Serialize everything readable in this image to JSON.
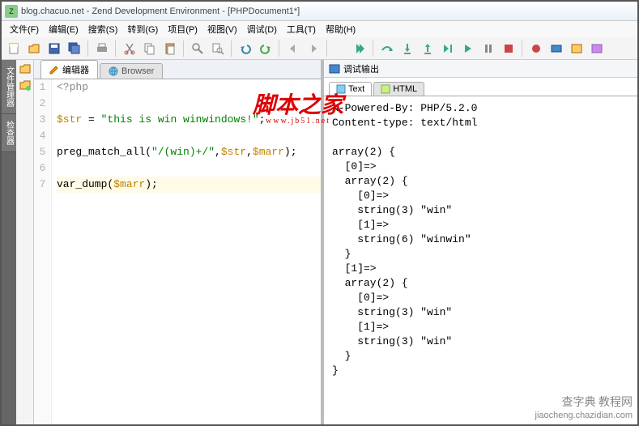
{
  "window": {
    "title": "blog.chacuo.net - Zend Development Environment - [PHPDocument1*]"
  },
  "menu": {
    "file": "文件(F)",
    "edit": "编辑(E)",
    "search": "搜索(S)",
    "goto": "转到(G)",
    "project": "项目(P)",
    "view": "视图(V)",
    "debug": "调试(D)",
    "tools": "工具(T)",
    "help": "帮助(H)"
  },
  "vtabs": {
    "file_manager": "文件管理器",
    "inspector": "检查器"
  },
  "editor_tabs": {
    "editor": "编辑器",
    "browser": "Browser"
  },
  "code": {
    "l1": "<?php",
    "l2": "",
    "l3_a": "$str",
    "l3_b": " = ",
    "l3_c": "\"this is win winwindows!\"",
    "l3_d": ";",
    "l4": "",
    "l5_a": "preg_match_all",
    "l5_b": "(",
    "l5_c": "\"/(win)+/\"",
    "l5_d": ",",
    "l5_e": "$str",
    "l5_f": ",",
    "l5_g": "$marr",
    "l5_h": ");",
    "l6": "",
    "l7_a": "var_dump",
    "l7_b": "(",
    "l7_c": "$marr",
    "l7_d": ");"
  },
  "line_numbers": {
    "n1": "1",
    "n2": "2",
    "n3": "3",
    "n4": "4",
    "n5": "5",
    "n6": "6",
    "n7": "7"
  },
  "output_panel": {
    "title": "调试输出",
    "tab_text": "Text",
    "tab_html": "HTML"
  },
  "output": {
    "h1": "X-Powered-By: PHP/5.2.0",
    "h2": "Content-type: text/html",
    "h3": "",
    "l1": "array(2) {",
    "l2": "  [0]=>",
    "l3": "  array(2) {",
    "l4": "    [0]=>",
    "l5": "    string(3) \"win\"",
    "l6": "    [1]=>",
    "l7": "    string(6) \"winwin\"",
    "l8": "  }",
    "l9": "  [1]=>",
    "l10": "  array(2) {",
    "l11": "    [0]=>",
    "l12": "    string(3) \"win\"",
    "l13": "    [1]=>",
    "l14": "    string(3) \"win\"",
    "l15": "  }",
    "l16": "}"
  },
  "watermark": {
    "main": "脚本之家",
    "sub": "www.jb51.net"
  },
  "bottom_wm": {
    "top": "查字典 教程网",
    "sub": "jiaocheng.chazidian.com"
  }
}
